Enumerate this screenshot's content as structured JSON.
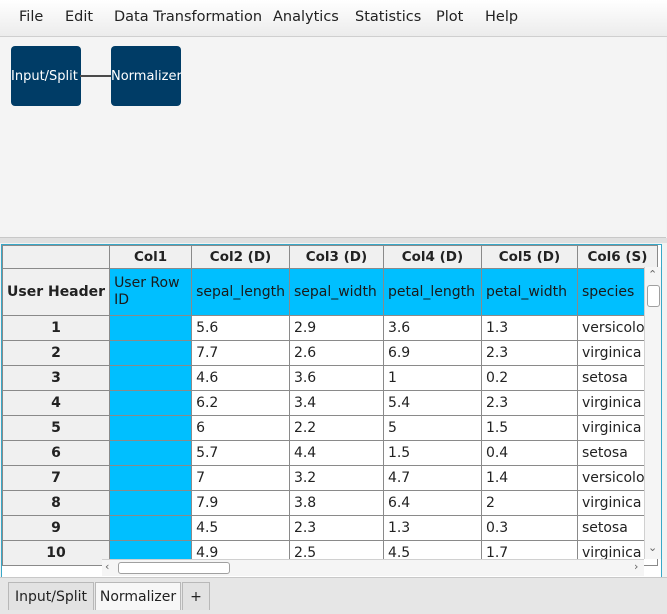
{
  "menu": [
    "File",
    "Edit",
    "Data Transformation",
    "Analytics",
    "Statistics",
    "Plot",
    "Help"
  ],
  "nodes": [
    "Input/Split",
    "Normalizer"
  ],
  "grid": {
    "col_headers": [
      "Col1",
      "Col2 (D)",
      "Col3 (D)",
      "Col4 (D)",
      "Col5 (D)",
      "Col6 (S)"
    ],
    "user_header_label": "User Header",
    "user_headers": [
      "User Row ID",
      "sepal_length",
      "sepal_width",
      "petal_length",
      "petal_width",
      "species"
    ],
    "rows": [
      {
        "n": "1",
        "c": [
          "5.6",
          "2.9",
          "3.6",
          "1.3",
          "versicolor"
        ]
      },
      {
        "n": "2",
        "c": [
          "7.7",
          "2.6",
          "6.9",
          "2.3",
          "virginica"
        ]
      },
      {
        "n": "3",
        "c": [
          "4.6",
          "3.6",
          "1",
          "0.2",
          "setosa"
        ]
      },
      {
        "n": "4",
        "c": [
          "6.2",
          "3.4",
          "5.4",
          "2.3",
          "virginica"
        ]
      },
      {
        "n": "5",
        "c": [
          "6",
          "2.2",
          "5",
          "1.5",
          "virginica"
        ]
      },
      {
        "n": "6",
        "c": [
          "5.7",
          "4.4",
          "1.5",
          "0.4",
          "setosa"
        ]
      },
      {
        "n": "7",
        "c": [
          "7",
          "3.2",
          "4.7",
          "1.4",
          "versicolor"
        ]
      },
      {
        "n": "8",
        "c": [
          "7.9",
          "3.8",
          "6.4",
          "2",
          "virginica"
        ]
      },
      {
        "n": "9",
        "c": [
          "4.5",
          "2.3",
          "1.3",
          "0.3",
          "setosa"
        ]
      },
      {
        "n": "10",
        "c": [
          "4.9",
          "2.5",
          "4.5",
          "1.7",
          "virginica"
        ]
      }
    ]
  },
  "tabs": [
    "Input/Split",
    "Normalizer",
    "+"
  ],
  "active_tab": "Normalizer",
  "colors": {
    "accent_cyan": "#00bfff",
    "node_blue": "#003c66"
  }
}
